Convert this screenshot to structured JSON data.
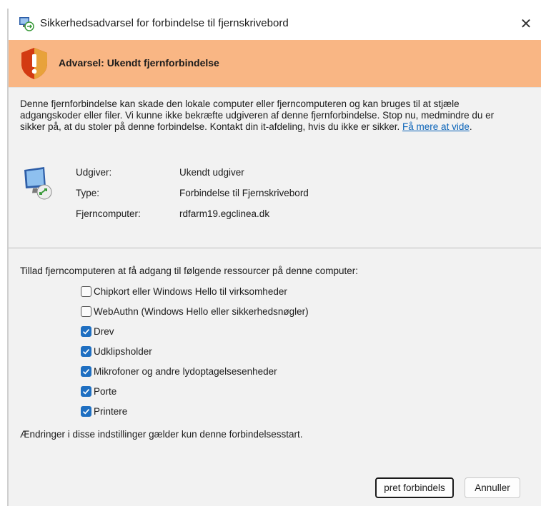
{
  "window": {
    "title": "Sikkerhedsadvarsel for forbindelse til fjernskrivebord",
    "close_glyph": "✕"
  },
  "warning": {
    "title": "Advarsel: Ukendt fjernforbindelse",
    "color": "#f9b684"
  },
  "description": {
    "text": "Denne fjernforbindelse kan skade den lokale computer eller fjerncomputeren og kan bruges til at stjæle adgangskoder eller filer. Vi kunne ikke bekræfte udgiveren af denne fjernforbindelse. Stop nu, medmindre du er sikker på, at du stoler på denne forbindelse. Kontakt din it-afdeling, hvis du ikke er sikker. ",
    "link": "Få mere at vide",
    "after_link": "."
  },
  "details": [
    {
      "label": "Udgiver:",
      "value": "Ukendt udgiver"
    },
    {
      "label": "Type:",
      "value": "Forbindelse til Fjernskrivebord"
    },
    {
      "label": "Fjerncomputer:",
      "value": "rdfarm19.egclinea.dk"
    }
  ],
  "resources": {
    "heading": "Tillad fjerncomputeren at få adgang til følgende ressourcer på denne computer:",
    "options": [
      {
        "label": "Chipkort eller Windows Hello til virksomheder",
        "checked": false
      },
      {
        "label": "WebAuthn (Windows Hello eller sikkerhedsnøgler)",
        "checked": false
      },
      {
        "label": "Drev",
        "checked": true
      },
      {
        "label": "Udklipsholder",
        "checked": true
      },
      {
        "label": "Mikrofoner og andre lydoptagelsesenheder",
        "checked": true
      },
      {
        "label": "Porte",
        "checked": true
      },
      {
        "label": "Printere",
        "checked": true
      }
    ],
    "note": "Ændringer i disse indstillinger gælder kun denne forbindelsesstart."
  },
  "buttons": {
    "connect": "pret forbindels",
    "cancel": "Annuller"
  },
  "colors": {
    "accent": "#1f6fc1",
    "link": "#0a63b8"
  }
}
